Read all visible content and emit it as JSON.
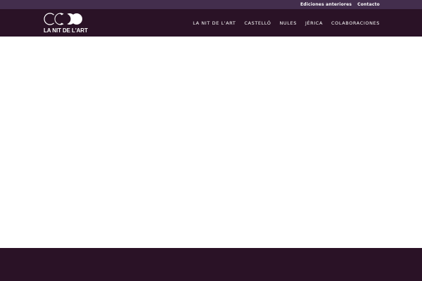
{
  "topbar": {
    "links": [
      {
        "label": "Ediciones anteriores"
      },
      {
        "label": "Contacto"
      }
    ]
  },
  "header": {
    "logo_text": "LA NIT DE L'ART",
    "nav": [
      {
        "label": "LA NIT DE L'ART"
      },
      {
        "label": "CASTELLÓ"
      },
      {
        "label": "NULES"
      },
      {
        "label": "JÉRICA"
      },
      {
        "label": "COLABORACIONES"
      }
    ]
  },
  "colors": {
    "topbar": "#432e4d",
    "header": "#2a1226",
    "footer": "#2a1226",
    "content": "#ffffff"
  }
}
